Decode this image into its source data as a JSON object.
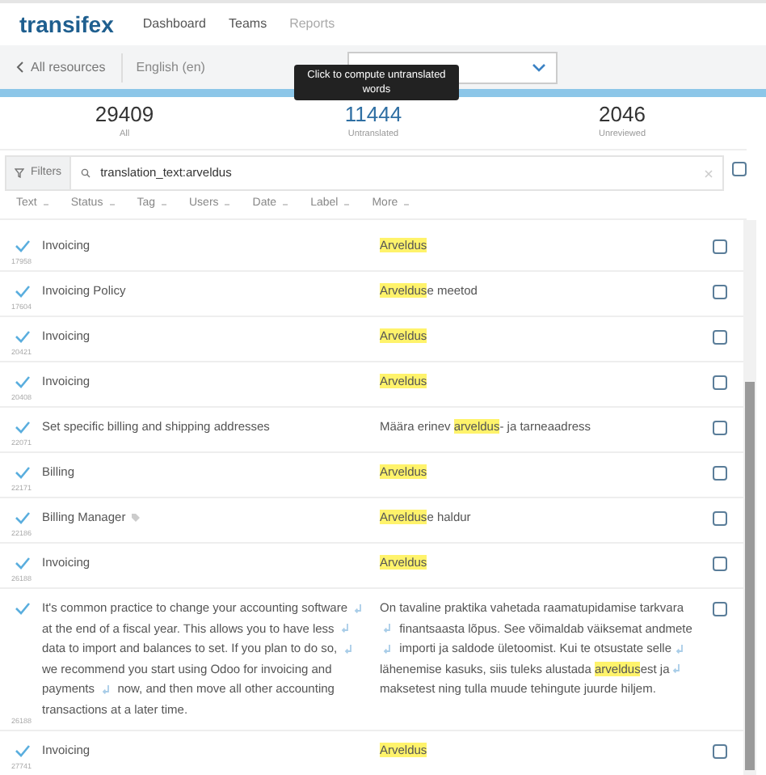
{
  "nav": {
    "logo": "transifex",
    "links": [
      {
        "label": "Dashboard",
        "disabled": false
      },
      {
        "label": "Teams",
        "disabled": false
      },
      {
        "label": "Reports",
        "disabled": true
      }
    ]
  },
  "toolbar": {
    "back": "All resources",
    "source_language": "English (en)"
  },
  "tooltip": "Click to compute untranslated words",
  "stats": [
    {
      "value": "29409",
      "label": "All",
      "selected": false
    },
    {
      "value": "11444",
      "label": "Untranslated",
      "selected": true
    },
    {
      "value": "2046",
      "label": "Unreviewed",
      "selected": false
    }
  ],
  "filters": {
    "button": "Filters",
    "query": "translation_text:arveldus",
    "checked": false
  },
  "columns": [
    "Text",
    "Status",
    "Tag",
    "Users",
    "Date",
    "Label",
    "More"
  ],
  "rows": [
    {
      "id": "17958",
      "source": [
        {
          "kind": "text",
          "text": "Invoicing"
        }
      ],
      "tagged": false,
      "translation": [
        {
          "kind": "text",
          "text": "Arveldus",
          "highlight": true
        }
      ],
      "checked": false
    },
    {
      "id": "17604",
      "source": [
        {
          "kind": "text",
          "text": "Invoicing Policy"
        }
      ],
      "tagged": false,
      "translation": [
        {
          "kind": "text",
          "text": "Arveldus",
          "highlight": true
        },
        {
          "kind": "text",
          "text": "e meetod",
          "highlight": false
        }
      ],
      "checked": false
    },
    {
      "id": "20421",
      "source": [
        {
          "kind": "text",
          "text": "Invoicing"
        }
      ],
      "tagged": false,
      "translation": [
        {
          "kind": "text",
          "text": "Arveldus",
          "highlight": true
        }
      ],
      "checked": false
    },
    {
      "id": "20408",
      "source": [
        {
          "kind": "text",
          "text": "Invoicing"
        }
      ],
      "tagged": false,
      "translation": [
        {
          "kind": "text",
          "text": "Arveldus",
          "highlight": true
        }
      ],
      "checked": false
    },
    {
      "id": "22071",
      "source": [
        {
          "kind": "text",
          "text": "Set specific billing and shipping addresses"
        }
      ],
      "tagged": false,
      "translation": [
        {
          "kind": "text",
          "text": "Määra erinev ",
          "highlight": false
        },
        {
          "kind": "text",
          "text": "arveldus",
          "highlight": true
        },
        {
          "kind": "text",
          "text": "- ja tarneaadress",
          "highlight": false
        }
      ],
      "checked": false
    },
    {
      "id": "22171",
      "source": [
        {
          "kind": "text",
          "text": "Billing"
        }
      ],
      "tagged": false,
      "translation": [
        {
          "kind": "text",
          "text": "Arveldus",
          "highlight": true
        }
      ],
      "checked": false
    },
    {
      "id": "22186",
      "source": [
        {
          "kind": "text",
          "text": "Billing Manager"
        }
      ],
      "tagged": true,
      "translation": [
        {
          "kind": "text",
          "text": "Arveldus",
          "highlight": true
        },
        {
          "kind": "text",
          "text": "e haldur",
          "highlight": false
        }
      ],
      "checked": false
    },
    {
      "id": "26188",
      "source": [
        {
          "kind": "text",
          "text": "Invoicing"
        }
      ],
      "tagged": false,
      "translation": [
        {
          "kind": "text",
          "text": "Arveldus",
          "highlight": true
        }
      ],
      "checked": false
    },
    {
      "id": "26188",
      "source": [
        {
          "kind": "text",
          "text": "It's common practice to change your accounting software "
        },
        {
          "kind": "mark"
        },
        {
          "kind": "text",
          "text": " at the end of a fiscal year. This allows you to have less "
        },
        {
          "kind": "mark"
        },
        {
          "kind": "text",
          "text": " data to import and balances to set. If you plan to do so, "
        },
        {
          "kind": "mark"
        },
        {
          "kind": "text",
          "text": " we recommend you start using Odoo for invoicing and payments "
        },
        {
          "kind": "mark"
        },
        {
          "kind": "text",
          "text": " now, and then move all other accounting transactions at a later time."
        }
      ],
      "tagged": false,
      "translation": [
        {
          "kind": "text",
          "text": "On tavaline praktika vahetada raamatupidamise tarkvara",
          "highlight": false
        },
        {
          "kind": "mark"
        },
        {
          "kind": "text",
          "text": " finantsaasta lõpus. See võimaldab väiksemat andmete ",
          "highlight": false
        },
        {
          "kind": "mark"
        },
        {
          "kind": "text",
          "text": " importi ja saldode ületoomist. Kui te otsustate selle",
          "highlight": false
        },
        {
          "kind": "mark"
        },
        {
          "kind": "text",
          "text": " lähenemise kasuks, siis tuleks alustada ",
          "highlight": false
        },
        {
          "kind": "text",
          "text": "arveldus",
          "highlight": true
        },
        {
          "kind": "text",
          "text": "est ja",
          "highlight": false
        },
        {
          "kind": "mark"
        },
        {
          "kind": "text",
          "text": " maksetest ning tulla muude tehingute juurde hiljem.",
          "highlight": false
        }
      ],
      "checked": false
    },
    {
      "id": "27741",
      "source": [
        {
          "kind": "text",
          "text": "Invoicing"
        }
      ],
      "tagged": false,
      "translation": [
        {
          "kind": "text",
          "text": "Arveldus",
          "highlight": true
        }
      ],
      "checked": false
    }
  ]
}
